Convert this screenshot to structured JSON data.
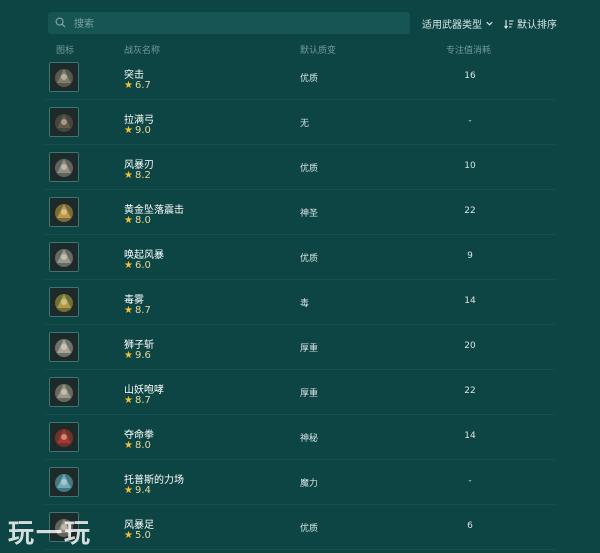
{
  "toolbar": {
    "search_placeholder": "搜索",
    "weapon_filter_label": "适用武器类型",
    "sort_label": "默认排序"
  },
  "columns": {
    "icon": "图标",
    "name": "战灰名称",
    "affinity": "默认质变",
    "fp_cost": "专注值消耗"
  },
  "ashes": [
    {
      "name": "突击",
      "rating": "6.7",
      "affinity": "优质",
      "fp": "16",
      "icon": "charge-icon",
      "color": "#8a8270"
    },
    {
      "name": "拉满弓",
      "rating": "9.0",
      "affinity": "无",
      "fp": "-",
      "icon": "bow-icon",
      "color": "#6b5d4e"
    },
    {
      "name": "风暴刃",
      "rating": "8.2",
      "affinity": "优质",
      "fp": "10",
      "icon": "storm-blade-icon",
      "color": "#9a948a"
    },
    {
      "name": "黄金坠落震击",
      "rating": "8.0",
      "affinity": "神圣",
      "fp": "22",
      "icon": "golden-slam-icon",
      "color": "#c9a14a"
    },
    {
      "name": "唤起风暴",
      "rating": "6.0",
      "affinity": "优质",
      "fp": "9",
      "icon": "storm-summon-icon",
      "color": "#a39f96"
    },
    {
      "name": "毒雾",
      "rating": "8.7",
      "affinity": "毒",
      "fp": "14",
      "icon": "poison-mist-icon",
      "color": "#b8a648"
    },
    {
      "name": "狮子斩",
      "rating": "9.6",
      "affinity": "厚重",
      "fp": "20",
      "icon": "lion-claw-icon",
      "color": "#b5aca2"
    },
    {
      "name": "山妖咆哮",
      "rating": "8.7",
      "affinity": "厚重",
      "fp": "22",
      "icon": "troll-roar-icon",
      "color": "#a69e8f"
    },
    {
      "name": "夺命拳",
      "rating": "8.0",
      "affinity": "神秘",
      "fp": "14",
      "icon": "blood-fist-icon",
      "color": "#b33a2c"
    },
    {
      "name": "托普斯的力场",
      "rating": "9.4",
      "affinity": "魔力",
      "fp": "-",
      "icon": "thops-barrier-icon",
      "color": "#6fb6c2"
    },
    {
      "name": "风暴足",
      "rating": "5.0",
      "affinity": "优质",
      "fp": "6",
      "icon": "storm-kick-icon",
      "color": "#9d968b"
    }
  ],
  "watermark": "玩一玩"
}
